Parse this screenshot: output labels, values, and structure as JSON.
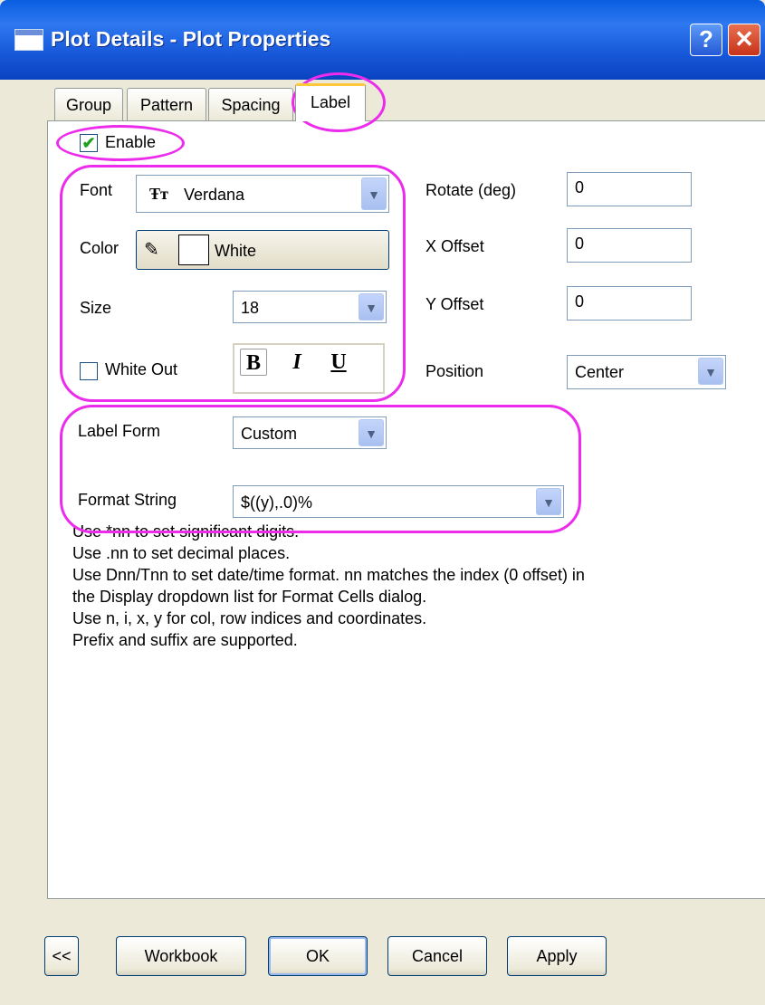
{
  "window": {
    "title": "Plot Details - Plot Properties",
    "help_glyph": "?",
    "close_glyph": "✕"
  },
  "tabs": [
    {
      "label": "Group"
    },
    {
      "label": "Pattern"
    },
    {
      "label": "Spacing"
    },
    {
      "label": "Label",
      "active": true
    }
  ],
  "label_tab": {
    "enable": {
      "label": "Enable",
      "checked": true
    },
    "font": {
      "label": "Font",
      "value": "Verdana",
      "icon": "truetype-font-icon"
    },
    "color": {
      "label": "Color",
      "value": "White",
      "swatch": "#ffffff"
    },
    "size": {
      "label": "Size",
      "value": "18"
    },
    "white_out": {
      "label": "White Out",
      "checked": false
    },
    "styles": {
      "bold": "B",
      "italic": "I",
      "underline": "U"
    },
    "rotate": {
      "label": "Rotate (deg)",
      "value": "0"
    },
    "x_offset": {
      "label": "X Offset",
      "value": "0"
    },
    "y_offset": {
      "label": "Y Offset",
      "value": "0"
    },
    "position": {
      "label": "Position",
      "value": "Center"
    },
    "label_form": {
      "label": "Label Form",
      "value": "Custom"
    },
    "format_string": {
      "label": "Format String",
      "value": "$((y),.0)%"
    },
    "help_lines": [
      "Use *nn to set significant digits.",
      "Use .nn to set decimal places.",
      "Use Dnn/Tnn to set date/time format. nn matches the index (0 offset) in",
      "the Display dropdown list for Format Cells dialog.",
      "Use n, i, x, y for col, row indices and coordinates.",
      "Prefix and suffix are supported."
    ]
  },
  "buttons": {
    "collapse": "<<",
    "workbook": "Workbook",
    "ok": "OK",
    "cancel": "Cancel",
    "apply": "Apply"
  },
  "colors": {
    "highlight": "#ec2bec",
    "title_bar": "#0a5de0",
    "check": "#21a121"
  }
}
